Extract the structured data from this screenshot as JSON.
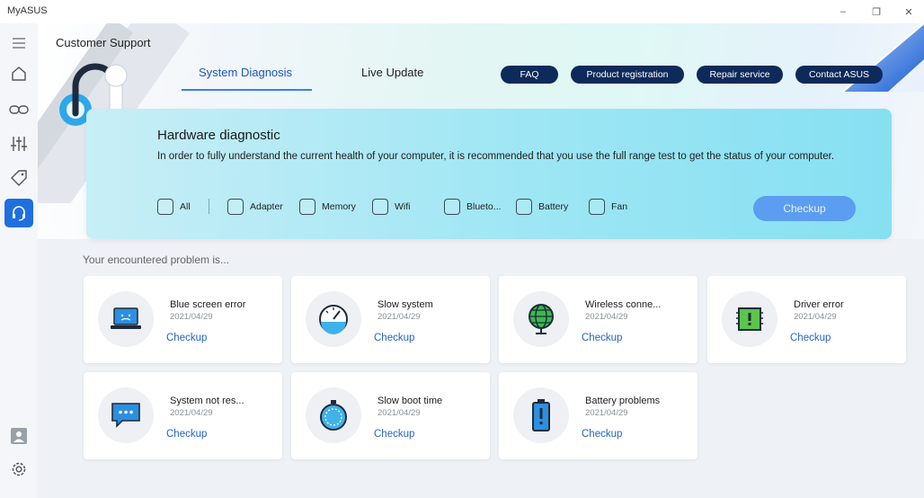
{
  "app": {
    "title": "MyASUS"
  },
  "window": {
    "minimize": "–",
    "maximize": "❐",
    "close": "✕"
  },
  "page": {
    "title": "Customer Support"
  },
  "tabs": [
    {
      "label": "System Diagnosis",
      "active": true
    },
    {
      "label": "Live Update",
      "active": false
    }
  ],
  "links": [
    "FAQ",
    "Product registration",
    "Repair service",
    "Contact ASUS"
  ],
  "diagnostic": {
    "title": "Hardware diagnostic",
    "description": "In order to fully understand the current health of your computer, it is recommended that you use the full range test to get the status of your computer.",
    "options": [
      "All",
      "Adapter",
      "Memory",
      "Wifi",
      "Blueto...",
      "Battery",
      "Fan"
    ],
    "button": "Checkup"
  },
  "problems_label": "Your encountered problem is...",
  "problems": [
    {
      "name": "Blue screen error",
      "date": "2021/04/29",
      "action": "Checkup",
      "icon": "laptop-icon"
    },
    {
      "name": "Slow system",
      "date": "2021/04/29",
      "action": "Checkup",
      "icon": "gauge-icon"
    },
    {
      "name": "Wireless conne...",
      "date": "2021/04/29",
      "action": "Checkup",
      "icon": "globe-icon"
    },
    {
      "name": "Driver error",
      "date": "2021/04/29",
      "action": "Checkup",
      "icon": "chip-icon"
    },
    {
      "name": "System not res...",
      "date": "2021/04/29",
      "action": "Checkup",
      "icon": "chat-bubble-icon"
    },
    {
      "name": "Slow boot time",
      "date": "2021/04/29",
      "action": "Checkup",
      "icon": "stopwatch-icon"
    },
    {
      "name": "Battery problems",
      "date": "2021/04/29",
      "action": "Checkup",
      "icon": "battery-icon"
    }
  ],
  "colors": {
    "accent": "#1f6fe0",
    "pill": "#0d2a5a",
    "link": "#2563c9",
    "card_gradient_end": "#86e0f2"
  }
}
